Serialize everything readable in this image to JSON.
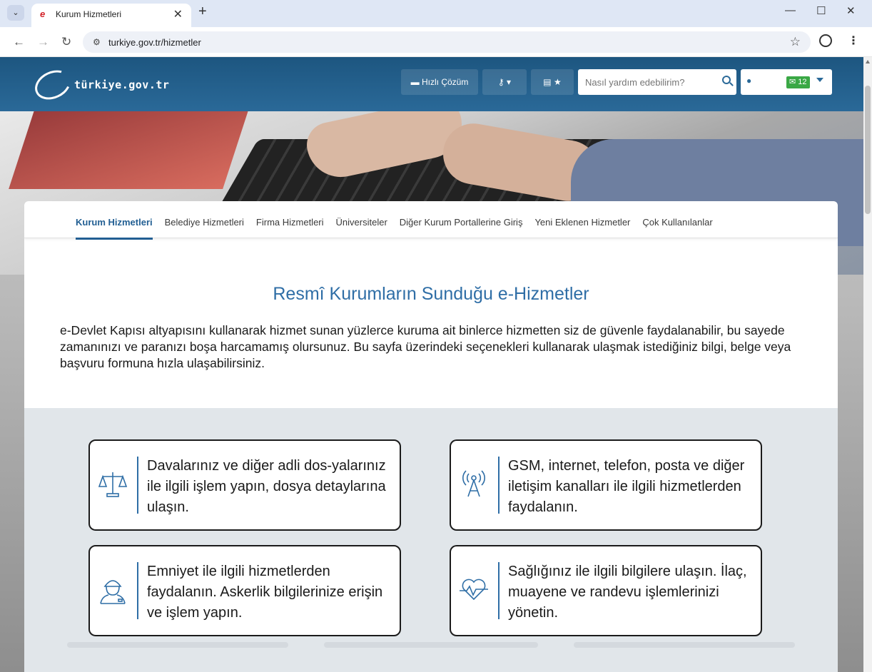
{
  "browser": {
    "tab_title": "Kurum Hizmetleri",
    "new_tab_label": "+",
    "url": "turkiye.gov.tr/hizmetler"
  },
  "site": {
    "logo_text": "türkiye.gov.tr",
    "header": {
      "quick_solution_label": "Hızlı Çözüm",
      "search_placeholder": "Nasıl yardım edebilirim?",
      "message_count": "12"
    },
    "tabs": [
      {
        "label": "Kurum Hizmetleri",
        "active": true
      },
      {
        "label": "Belediye Hizmetleri",
        "active": false
      },
      {
        "label": "Firma Hizmetleri",
        "active": false
      },
      {
        "label": "Üniversiteler",
        "active": false
      },
      {
        "label": "Diğer Kurum Portallerine Giriş",
        "active": false
      },
      {
        "label": "Yeni Eklenen Hizmetler",
        "active": false
      },
      {
        "label": "Çok Kullanılanlar",
        "active": false
      }
    ],
    "page_title": "Resmî Kurumların Sunduğu e-Hizmetler",
    "intro": "e-Devlet Kapısı altyapısını kullanarak hizmet sunan yüzlerce kuruma ait binlerce hizmetten siz de güvenle faydalanabilir, bu sayede zamanınızı ve paranızı boşa harcamamış olursunuz. Bu sayfa üzerindeki seçenekleri kullanarak ulaşmak istediğiniz bilgi, belge veya başvuru formuna hızla ulaşabilirsiniz.",
    "services": [
      {
        "icon": "scales-icon",
        "text": "Davalarınız ve diğer adli dos-yalarınız ile ilgili işlem yapın, dosya detaylarına ulaşın."
      },
      {
        "icon": "antenna-icon",
        "text": "GSM, internet, telefon, posta ve diğer iletişim kanalları ile ilgili hizmetlerden faydalanın."
      },
      {
        "icon": "soldier-icon",
        "text": "Emniyet ile ilgili hizmetlerden faydalanın. Askerlik bilgilerinize erişin ve işlem yapın."
      },
      {
        "icon": "heartbeat-icon",
        "text": "Sağlığınız ile ilgili bilgilere ulaşın. İlaç, muayene ve randevu işlemlerinizi yönetin."
      }
    ]
  }
}
